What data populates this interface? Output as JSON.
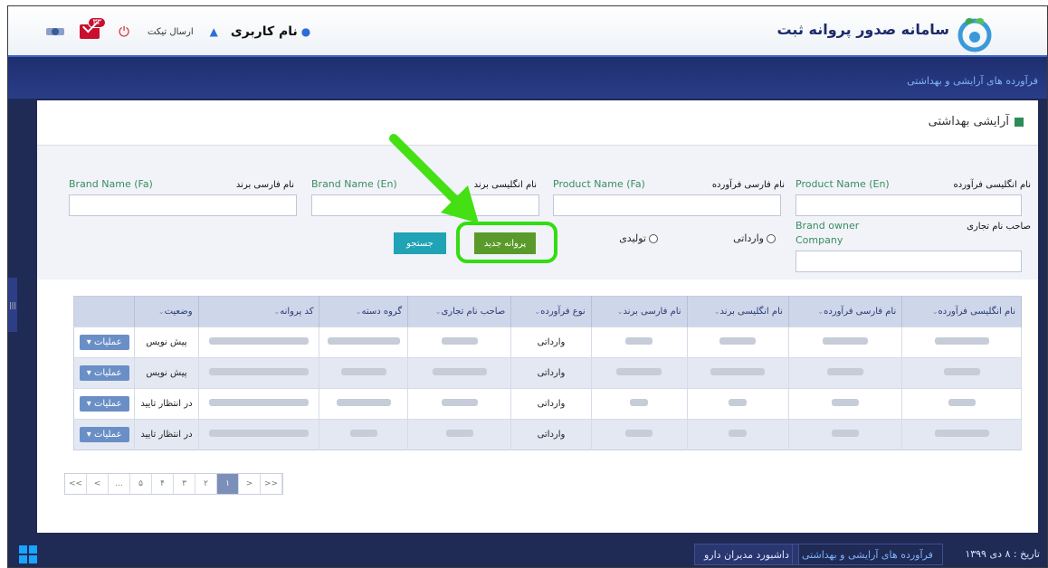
{
  "header": {
    "app_title": "سامانه صدور پروانه ثبت",
    "username": "نام کاربری",
    "send_ticket": "ارسال تیکت",
    "mail_badge": "۳۳"
  },
  "subheader": {
    "category": "فرآورده های آرایشی و بهداشتی"
  },
  "panel": {
    "title": "آرایشی بهداشتی"
  },
  "filters": {
    "product_name_en_fa": "نام انگلیسی فرآورده",
    "product_name_en": "Product Name (En)",
    "product_name_fa_fa": "نام فارسی فرآورده",
    "product_name_fa": "Product Name (Fa)",
    "brand_name_en_fa": "نام انگلیسی برند",
    "brand_name_en": "Brand Name (En)",
    "brand_name_fa_fa": "نام فارسی برند",
    "brand_name_fa": "Brand Name (Fa)",
    "brand_owner_fa": "صاحب نام تجاری",
    "brand_owner_en_1": "Brand owner",
    "brand_owner_en_2": "Company",
    "radio_import": "وارداتی",
    "radio_produce": "تولیدی",
    "new_license": "پروانه جدید",
    "search": "جستجو"
  },
  "table": {
    "headers": [
      "نام انگلیسی فرآورده",
      "نام فارسی فرآورده",
      "نام انگلیسی برند",
      "نام فارسی برند",
      "نوع فرآورده",
      "صاحب نام تجاری",
      "گروه دسته",
      "کد پروانه",
      "وضعیت"
    ],
    "rows": [
      {
        "type": "وارداتی",
        "status": "پیش نویس"
      },
      {
        "type": "وارداتی",
        "status": "پیش نویس"
      },
      {
        "type": "وارداتی",
        "status": "در انتظار تایید"
      },
      {
        "type": "وارداتی",
        "status": "در انتظار تایید"
      }
    ],
    "ops_label": "عملیات"
  },
  "pager": [
    "<<",
    "<",
    "...",
    "۵",
    "۴",
    "۳",
    "۲",
    "۱",
    ">",
    ">>"
  ],
  "footer": {
    "date": "تاریخ : ۸ دی ۱۳۹۹",
    "tab_active": "فرآورده های آرایشی و بهداشتی",
    "tab_dashboard": "داشبورد مدیران دارو"
  }
}
